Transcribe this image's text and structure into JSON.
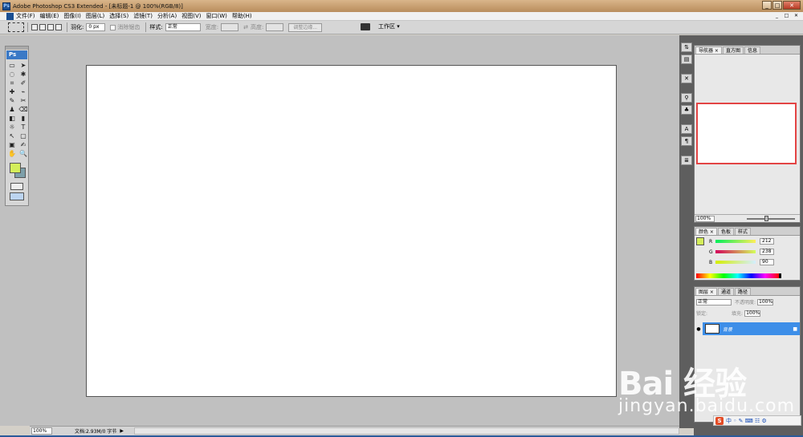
{
  "window": {
    "title": "Adobe Photoshop CS3 Extended - [未标题-1 @ 100%(RGB/8)]",
    "app_badge": "Ps",
    "min": "_",
    "max": "□",
    "close": "✕"
  },
  "menu": {
    "items": [
      "文件(F)",
      "编辑(E)",
      "图像(I)",
      "图层(L)",
      "选择(S)",
      "滤镜(T)",
      "分析(A)",
      "视图(V)",
      "窗口(W)",
      "帮助(H)"
    ],
    "doc_min": "_",
    "doc_max": "□",
    "doc_close": "✕"
  },
  "options": {
    "feather_label": "羽化:",
    "feather_value": "0 px",
    "antialias_label": "消除锯齿",
    "style_label": "样式:",
    "style_value": "正常",
    "width_label": "宽度:",
    "height_label": "高度:",
    "refine_edge": "调整边缘...",
    "workspace": "工作区 ▾"
  },
  "toolbox": {
    "header": "Ps",
    "tools": [
      "▭",
      "➤",
      "◌",
      "✱",
      "⌗",
      "✐",
      "✚",
      "⌁",
      "✎",
      "✂",
      "♟",
      "⌫",
      "◧",
      "▮",
      "☼",
      "◐",
      "♦",
      "T",
      "↖",
      "▢",
      "▣",
      "✍",
      "✋",
      "🔍"
    ]
  },
  "colors": {
    "foreground": "#d4ee5a",
    "background": "#7d9fa9"
  },
  "status": {
    "zoom": "100%",
    "doc_info": "文档:2.93M/0 字节",
    "arrow": "▶"
  },
  "dock_icons": [
    "⇅",
    "▤",
    "✕",
    "⚲",
    "♣",
    "A",
    "¶",
    "≣"
  ],
  "navigator": {
    "tabs": [
      "导航器 ×",
      "直方图",
      "信息"
    ],
    "zoom": "100%"
  },
  "color_panel": {
    "tabs": [
      "颜色 ×",
      "色板",
      "样式"
    ],
    "channels": [
      {
        "label": "R",
        "value": "212"
      },
      {
        "label": "G",
        "value": "238"
      },
      {
        "label": "B",
        "value": "90"
      }
    ]
  },
  "layers": {
    "tabs": [
      "图层 ×",
      "通道",
      "路径"
    ],
    "blend_mode": "正常",
    "opacity_label": "不透明度:",
    "opacity_value": "100%",
    "lock_label": "锁定:",
    "fill_label": "填充:",
    "fill_value": "100%",
    "layer_name": "背景"
  },
  "watermark": {
    "brand": "Bai  经验",
    "url": "jingyan.baidu.com"
  },
  "tray": {
    "ime": "S",
    "text": "中 ◦ ✎ ⌨ ☷ ⚙"
  }
}
